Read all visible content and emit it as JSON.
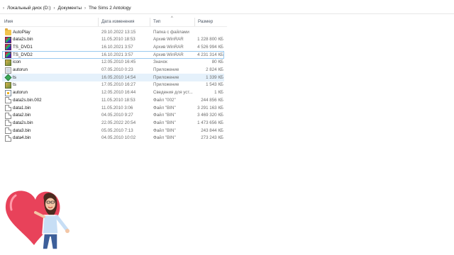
{
  "breadcrumb": [
    "Локальный диск (D:)",
    "Документы",
    "The Sims 2 Antology"
  ],
  "columns": {
    "name": "Имя",
    "date": "Дата изменения",
    "type": "Тип",
    "size": "Размер"
  },
  "files": [
    {
      "name": "AutoPlay",
      "date": "29.10.2022 13:15",
      "type": "Папка с файлами",
      "size": "",
      "icon": "folder-icon"
    },
    {
      "name": "data2s.bin",
      "date": "11.05.2010 18:53",
      "type": "Архив WinRAR",
      "size": "1 228 800 КБ",
      "icon": "winrar-icon"
    },
    {
      "name": "TS_DVD1",
      "date": "16.10.2021 3:57",
      "type": "Архив WinRAR",
      "size": "4 526 994 КБ",
      "icon": "winrar-icon"
    },
    {
      "name": "TS_DVD2",
      "date": "16.10.2021 3:57",
      "type": "Архив WinRAR",
      "size": "4 231 314 КБ",
      "icon": "winrar-icon"
    },
    {
      "name": "icon",
      "date": "12.05.2010 16:45",
      "type": "Значок",
      "size": "80 КБ",
      "icon": "ico-icon"
    },
    {
      "name": "autorun",
      "date": "07.05.2010 0:23",
      "type": "Приложение",
      "size": "2 824 КБ",
      "icon": "application-icon"
    },
    {
      "name": "ts",
      "date": "16.05.2010 14:54",
      "type": "Приложение",
      "size": "1 339 КБ",
      "icon": "sims-icon"
    },
    {
      "name": "ts",
      "date": "17.05.2010 16:27",
      "type": "Приложение",
      "size": "1 543 КБ",
      "icon": "ico-icon"
    },
    {
      "name": "autorun",
      "date": "12.05.2010 16:44",
      "type": "Сведения для уст...",
      "size": "1 КБ",
      "icon": "setup-info-icon"
    },
    {
      "name": "data2s.bin.002",
      "date": "11.05.2010 18:53",
      "type": "Файл \"002\"",
      "size": "244 856 КБ",
      "icon": "file-icon"
    },
    {
      "name": "data1.bin",
      "date": "11.05.2010 3:06",
      "type": "Файл \"BIN\"",
      "size": "3 291 163 КБ",
      "icon": "file-icon"
    },
    {
      "name": "data2.bin",
      "date": "04.05.2010 9:27",
      "type": "Файл \"BIN\"",
      "size": "3 469 320 КБ",
      "icon": "file-icon"
    },
    {
      "name": "data2s.bin",
      "date": "22.05.2022 20:54",
      "type": "Файл \"BIN\"",
      "size": "1 473 656 КБ",
      "icon": "file-icon"
    },
    {
      "name": "data3.bin",
      "date": "05.05.2010 7:13",
      "type": "Файл \"BIN\"",
      "size": "243 844 КБ",
      "icon": "file-icon"
    },
    {
      "name": "data4.bin",
      "date": "04.05.2010 10:02",
      "type": "Файл \"BIN\"",
      "size": "273 243 КБ",
      "icon": "file-icon"
    }
  ],
  "selected_row": 6,
  "outlined_row": 3,
  "sticker": {
    "icon": "heart-avatar-sticker"
  }
}
